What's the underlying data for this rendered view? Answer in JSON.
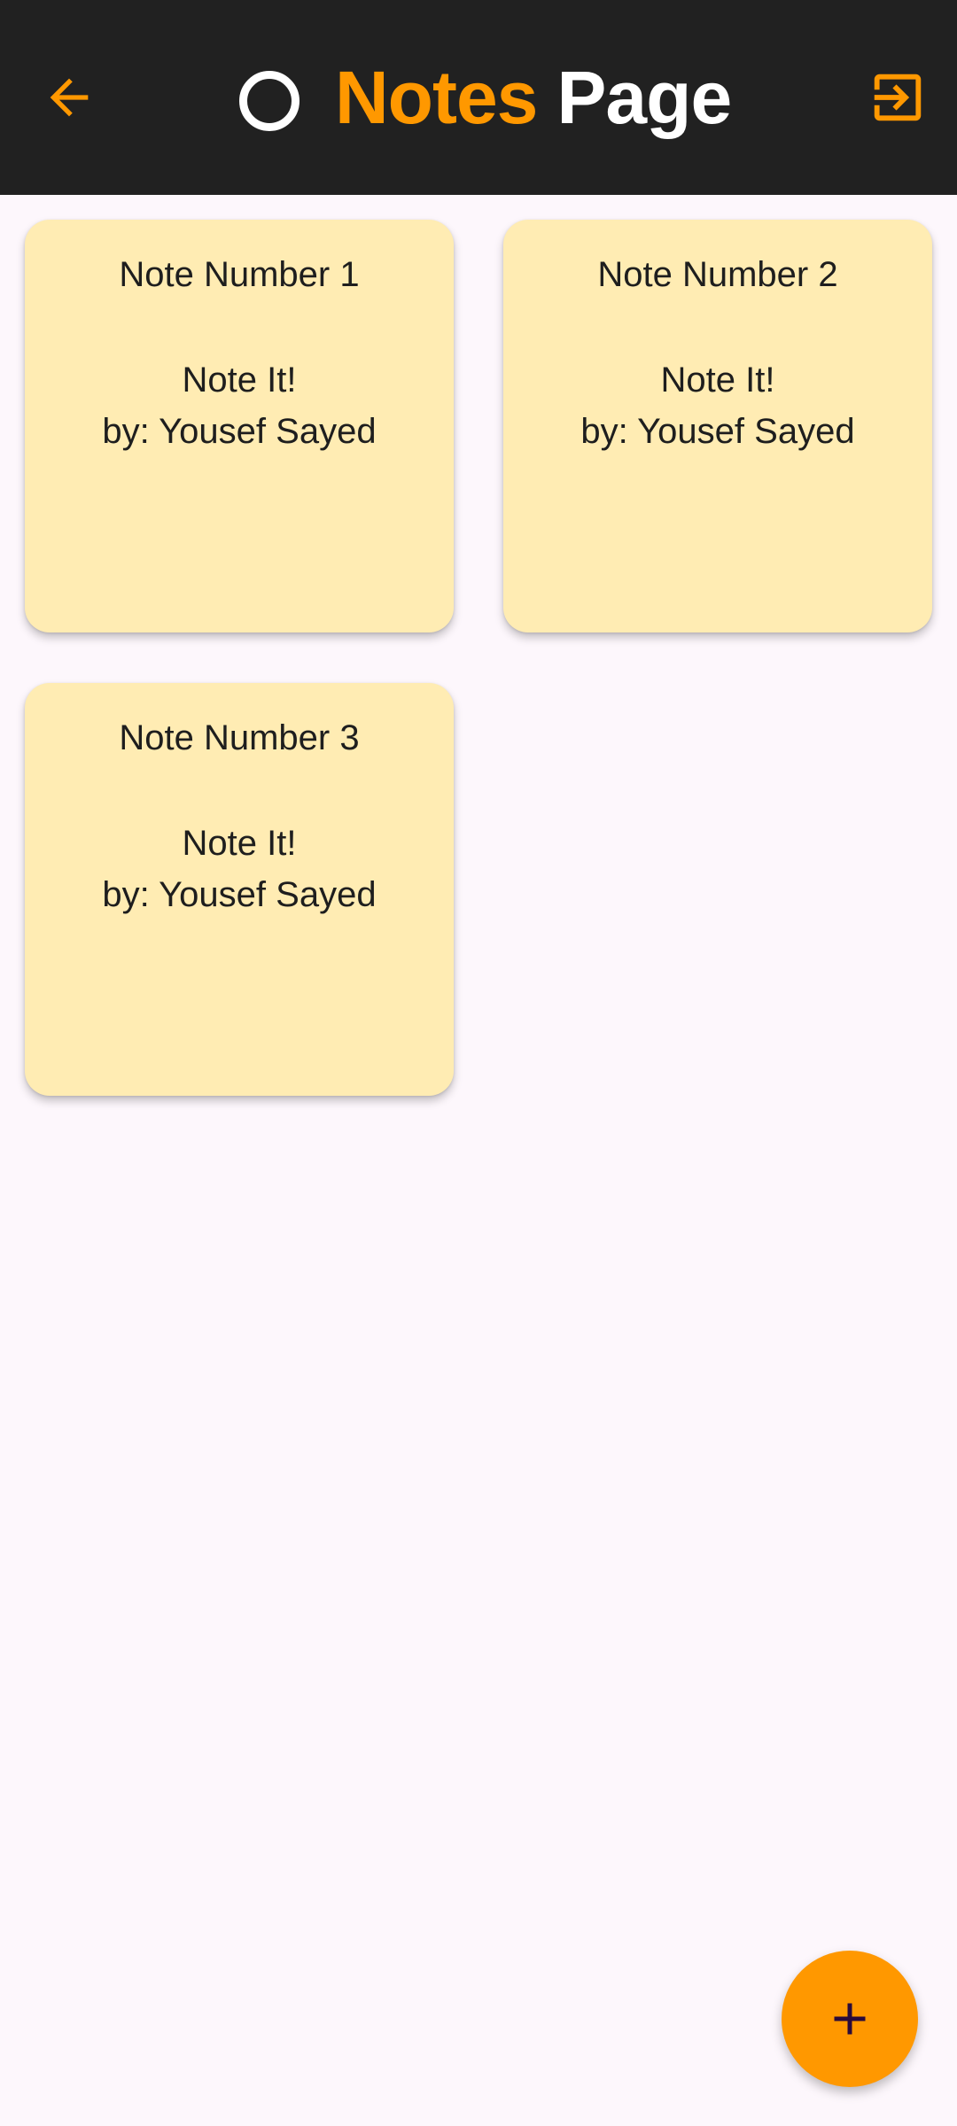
{
  "header": {
    "title_part1": "Notes",
    "title_part2": "Page",
    "back_icon": "arrow-back-icon",
    "exit_icon": "exit-to-app-icon",
    "logo_icon": "ring-icon",
    "colors": {
      "bar": "#212121",
      "accent": "#FF9800",
      "title_secondary": "#FFFFFF"
    }
  },
  "notes": [
    {
      "title": "Note Number 1",
      "line1": "Note It!",
      "line2": "by: Yousef Sayed"
    },
    {
      "title": "Note Number 2",
      "line1": "Note It!",
      "line2": "by: Yousef Sayed"
    },
    {
      "title": "Note Number 3",
      "line1": "Note It!",
      "line2": "by: Yousef Sayed"
    }
  ],
  "fab": {
    "icon": "add-icon",
    "color": "#FF9800",
    "icon_color": "#2A0A3A"
  },
  "colors": {
    "background": "#FDF7FC",
    "card": "#FFECB3",
    "text": "#1E1E1E"
  }
}
